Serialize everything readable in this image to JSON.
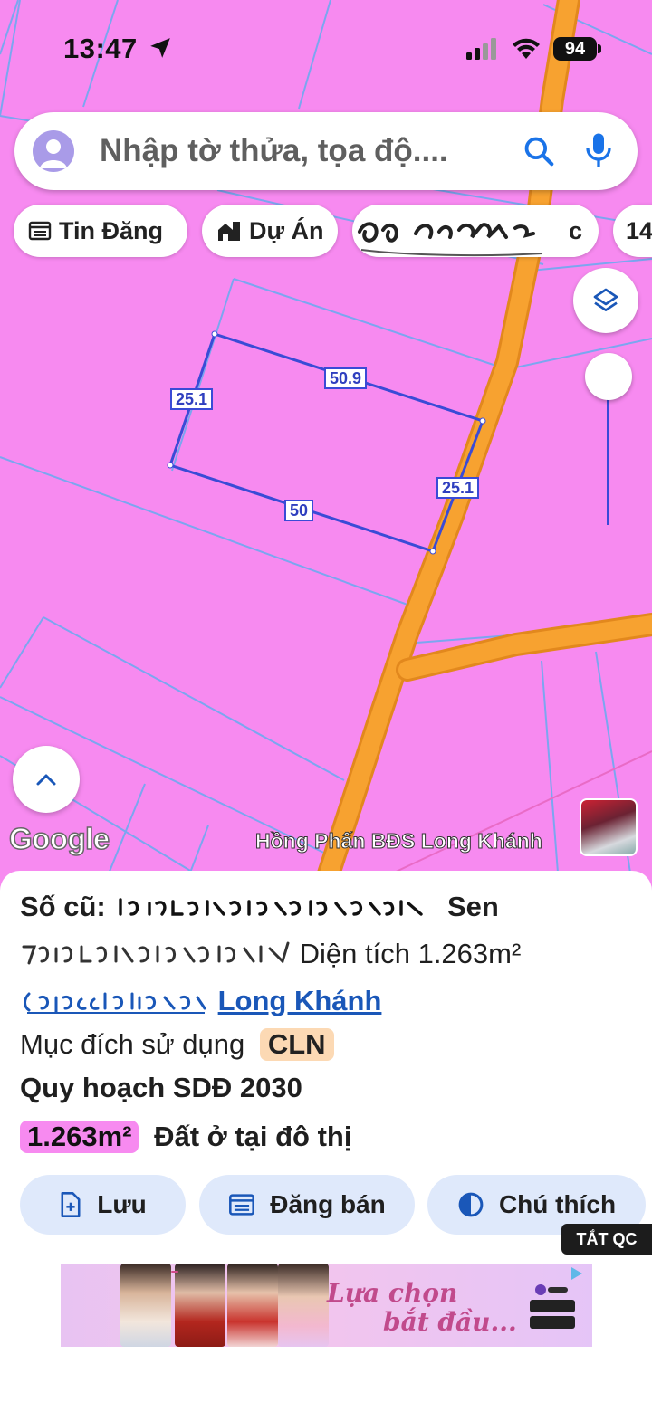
{
  "status_bar": {
    "time": "13:47",
    "battery": "94"
  },
  "search": {
    "placeholder": "Nhập tờ thửa, tọa độ...."
  },
  "chips": [
    {
      "label": "Tin Đăng",
      "icon": "listing-icon"
    },
    {
      "label": "Dự Án",
      "icon": "building-icon"
    },
    {
      "label": "c"
    },
    {
      "label": "14"
    }
  ],
  "map": {
    "dimensions": [
      "25.1",
      "50.9",
      "25.1",
      "50"
    ],
    "google_label": "Google",
    "watermark": "Hồng Phấn BĐS Long Khánh",
    "colors": {
      "land": "#f78af0",
      "parcel_lines": "#7ba6f0",
      "road": "#f7a230",
      "plot_outline": "#3a4bd6"
    }
  },
  "info": {
    "old_number_label": "Số cũ:",
    "old_number_suffix": "Sen",
    "area_label": "Diện tích 1.263m²",
    "district_link": "Long Khánh",
    "purpose_label": "Mục đích sử dụng",
    "purpose_badge": "CLN",
    "plan_label": "Quy hoạch SDĐ 2030",
    "plan_area": "1.263m²",
    "plan_type": "Đất ở tại đô thị"
  },
  "actions": {
    "save": "Lưu",
    "post": "Đăng bán",
    "legend": "Chú thích"
  },
  "ad": {
    "close_label": "TẮT QC",
    "headline_1": "Lựa chọn",
    "headline_2": "bắt đầu..."
  }
}
